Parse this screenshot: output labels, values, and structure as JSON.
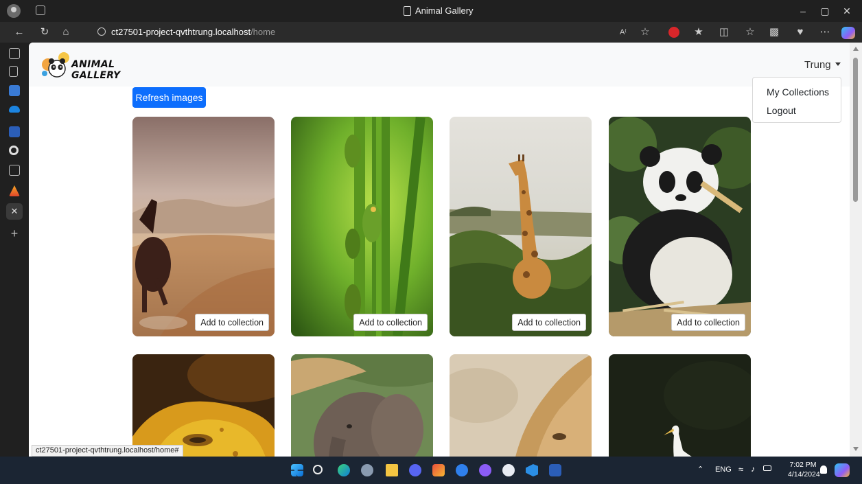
{
  "window": {
    "tab_title": "Animal Gallery"
  },
  "address_bar": {
    "host": "ct27501-project-qvthtrung.localhost",
    "path": "/home"
  },
  "site": {
    "logo_text": "ANIMAL GALLERY",
    "user_name": "Trung",
    "dropdown": [
      "My Collections",
      "Logout"
    ],
    "refresh_label": "Refresh images",
    "add_label": "Add to collection"
  },
  "cards": [
    {
      "animal": "horse"
    },
    {
      "animal": "frogs"
    },
    {
      "animal": "giraffe"
    },
    {
      "animal": "panda"
    },
    {
      "animal": "iguana"
    },
    {
      "animal": "elephant"
    },
    {
      "animal": "lion"
    },
    {
      "animal": "egret"
    }
  ],
  "status_bar": {
    "url": "ct27501-project-qvthtrung.localhost/home#"
  },
  "taskbar": {
    "language": "ENG",
    "time": "7:02 PM",
    "date": "4/14/2024"
  },
  "icons": [
    "profile-icon",
    "workspaces-icon",
    "back-icon",
    "refresh-icon",
    "home-icon",
    "info-icon",
    "read-aloud-icon",
    "favorite-icon",
    "adblock-icon",
    "extensions-icon",
    "split-screen-icon",
    "favorites-icon",
    "collections-icon",
    "performance-icon",
    "more-icon",
    "copilot-icon",
    "minimize-icon",
    "maximize-icon",
    "close-icon",
    "start-icon",
    "search-icon",
    "edge-icon",
    "settings-icon",
    "file-explorer-icon",
    "discord-icon",
    "zalo-icon",
    "vscode-icon",
    "word-icon",
    "wifi-icon",
    "volume-icon",
    "battery-icon",
    "notification-icon"
  ],
  "colors": {
    "accent": "#0d6efd",
    "navbar_bg": "#f8f9fa",
    "browser_chrome": "#202020"
  }
}
